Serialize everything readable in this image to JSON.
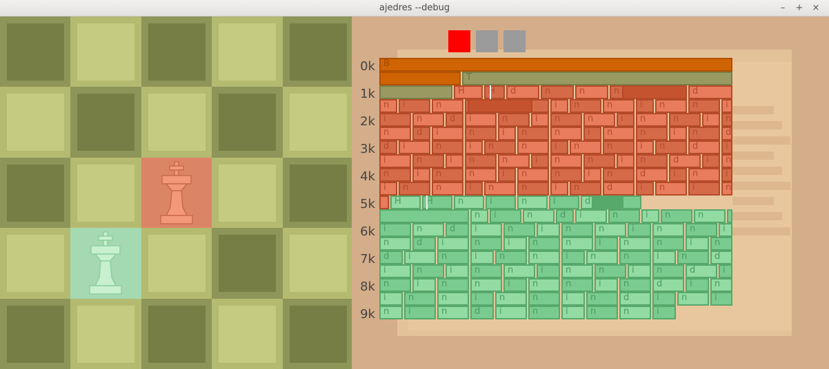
{
  "window": {
    "title": "ajedres --debug",
    "controls": [
      "–",
      "+",
      "×"
    ]
  },
  "board": {
    "size": 5,
    "pieces": [
      {
        "name": "red-king",
        "row": 2,
        "col": 2,
        "color": "#f39878",
        "shadow": "#c96a4c"
      },
      {
        "name": "green-king",
        "row": 3,
        "col": 1,
        "color": "#c8f0cf",
        "shadow": "#8fcf9e"
      }
    ],
    "highlights": [
      {
        "row": 2,
        "col": 2,
        "kind": "hl-red"
      },
      {
        "row": 3,
        "col": 1,
        "kind": "hl-green"
      }
    ]
  },
  "debug": {
    "swatches": [
      {
        "name": "red",
        "color": "#ff0000"
      },
      {
        "name": "gray-1",
        "color": "#9b9b9b"
      },
      {
        "name": "gray-2",
        "color": "#9b9b9b"
      }
    ],
    "y_labels": [
      "0k",
      "1k",
      "2k",
      "3k",
      "4k",
      "5k",
      "6k",
      "7k",
      "8k",
      "9k"
    ],
    "colors": {
      "header": "#d06404",
      "header_border": "#b05000",
      "olive": "#989a62",
      "olive_border": "#7a7d48",
      "red_light": "#e87c5c",
      "red_dark": "#d56a48",
      "red_border": "#b44a28",
      "green_light": "#92dba3",
      "green_dark": "#7acb90",
      "green_border": "#57a86b",
      "text_red": "#b24b2e",
      "text_green": "#4d9a62"
    },
    "markers": {
      "B": "B",
      "T": "T",
      "H": "H",
      "h": "H",
      "d": "d",
      "i": "i",
      "n": "n"
    }
  }
}
